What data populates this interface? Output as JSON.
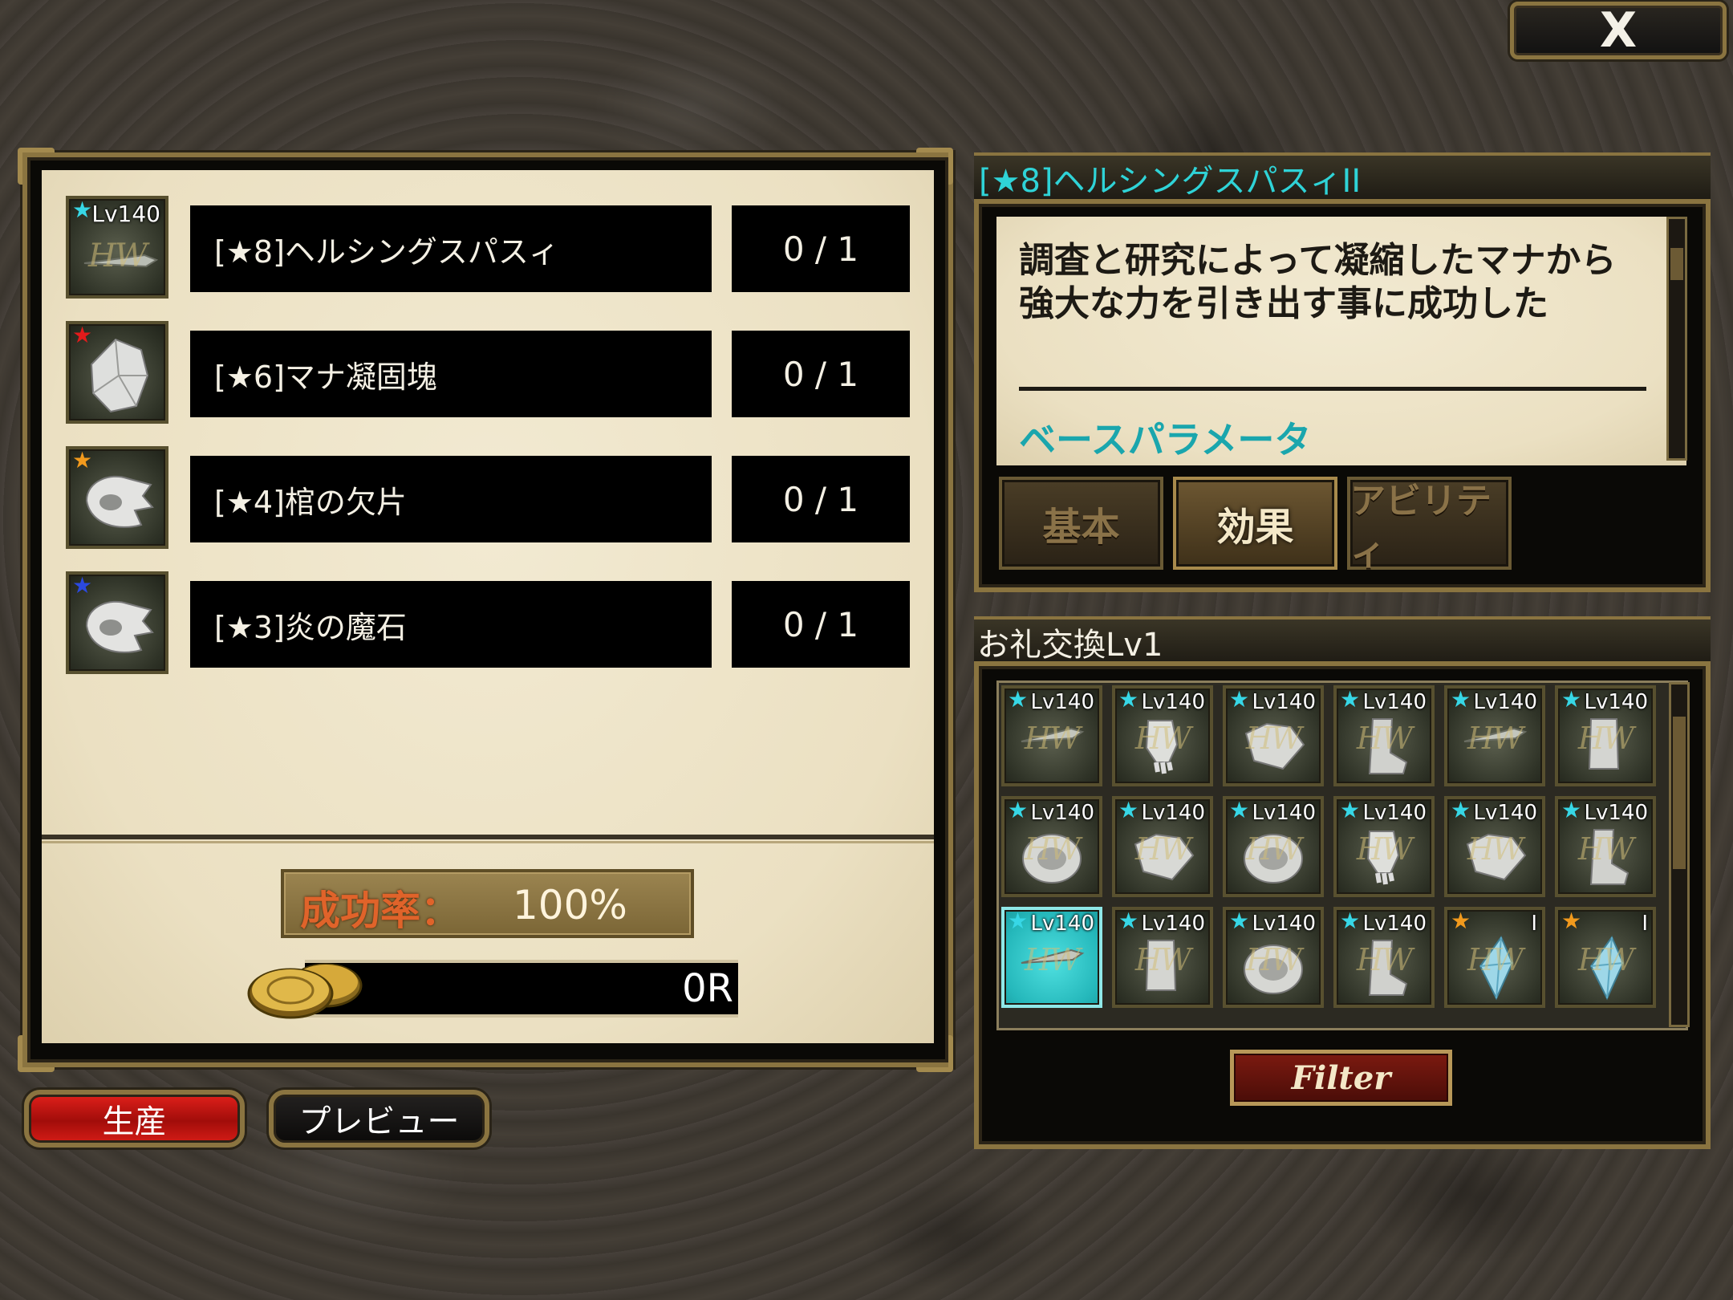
{
  "close_button": {
    "label": "X"
  },
  "materials": [
    {
      "name": "[★8]ヘルシングスパスィ",
      "count": "0 / 1",
      "star_color": "#37d7e6",
      "level": "Lv140",
      "icon": "weapon-hw-icon",
      "badge": "HW"
    },
    {
      "name": "[★6]マナ凝固塊",
      "count": "0 / 1",
      "star_color": "#e21b1b",
      "icon": "crystal-ore-icon"
    },
    {
      "name": "[★4]棺の欠片",
      "count": "0 / 1",
      "star_color": "#f29a1d",
      "icon": "fragment-icon"
    },
    {
      "name": "[★3]炎の魔石",
      "count": "0 / 1",
      "star_color": "#2b49e0",
      "icon": "fragment-icon"
    }
  ],
  "success_rate": {
    "label": "成功率：",
    "value": "100%"
  },
  "cost": {
    "value": "0R",
    "icon": "coin-icon"
  },
  "buttons": {
    "produce": "生産",
    "preview": "プレビュー"
  },
  "detail": {
    "title": "[★8]ヘルシングスパスィII",
    "description": "調査と研究によって凝縮したマナから強大な力を引き出す事に成功した",
    "section_label": "ベースパラメータ",
    "tabs": [
      {
        "label": "基本",
        "active": false
      },
      {
        "label": "効果",
        "active": true
      },
      {
        "label": "アビリティ",
        "active": false
      }
    ]
  },
  "exchange": {
    "title": "お礼交換Lv1",
    "filter_label": "Filter",
    "items": [
      {
        "level": "Lv140",
        "star_color": "#37d7e6",
        "badge": "HW",
        "icon": "sword-icon",
        "selected": false
      },
      {
        "level": "Lv140",
        "star_color": "#37d7e6",
        "badge": "HW",
        "icon": "gauntlet-icon",
        "selected": false
      },
      {
        "level": "Lv140",
        "star_color": "#37d7e6",
        "badge": "HW",
        "icon": "armor-icon",
        "selected": false
      },
      {
        "level": "Lv140",
        "star_color": "#37d7e6",
        "badge": "HW",
        "icon": "boot-icon",
        "selected": false
      },
      {
        "level": "Lv140",
        "star_color": "#37d7e6",
        "badge": "HW",
        "icon": "sword-icon",
        "selected": false
      },
      {
        "level": "Lv140",
        "star_color": "#37d7e6",
        "badge": "HW",
        "icon": "greaves-icon",
        "selected": false
      },
      {
        "level": "Lv140",
        "star_color": "#37d7e6",
        "badge": "HW",
        "icon": "shield-icon",
        "selected": false
      },
      {
        "level": "Lv140",
        "star_color": "#37d7e6",
        "badge": "HW",
        "icon": "armor-icon",
        "selected": false
      },
      {
        "level": "Lv140",
        "star_color": "#37d7e6",
        "badge": "HW",
        "icon": "shield-icon",
        "selected": false
      },
      {
        "level": "Lv140",
        "star_color": "#37d7e6",
        "badge": "HW",
        "icon": "gauntlet-icon",
        "selected": false
      },
      {
        "level": "Lv140",
        "star_color": "#37d7e6",
        "badge": "HW",
        "icon": "armor-icon",
        "selected": false
      },
      {
        "level": "Lv140",
        "star_color": "#37d7e6",
        "badge": "HW",
        "icon": "boot-icon",
        "selected": false
      },
      {
        "level": "Lv140",
        "star_color": "#37d7e6",
        "badge": "HW",
        "icon": "sword-icon",
        "selected": true
      },
      {
        "level": "Lv140",
        "star_color": "#37d7e6",
        "badge": "HW",
        "icon": "greaves-icon",
        "selected": false
      },
      {
        "level": "Lv140",
        "star_color": "#37d7e6",
        "badge": "HW",
        "icon": "shield-icon",
        "selected": false
      },
      {
        "level": "Lv140",
        "star_color": "#37d7e6",
        "badge": "HW",
        "icon": "boot-icon",
        "selected": false
      },
      {
        "level": "I",
        "star_color": "#f29a1d",
        "badge": "HW",
        "icon": "crystal-icon",
        "selected": false
      },
      {
        "level": "I",
        "star_color": "#f29a1d",
        "badge": "HW",
        "icon": "crystal-icon",
        "selected": false
      }
    ]
  }
}
